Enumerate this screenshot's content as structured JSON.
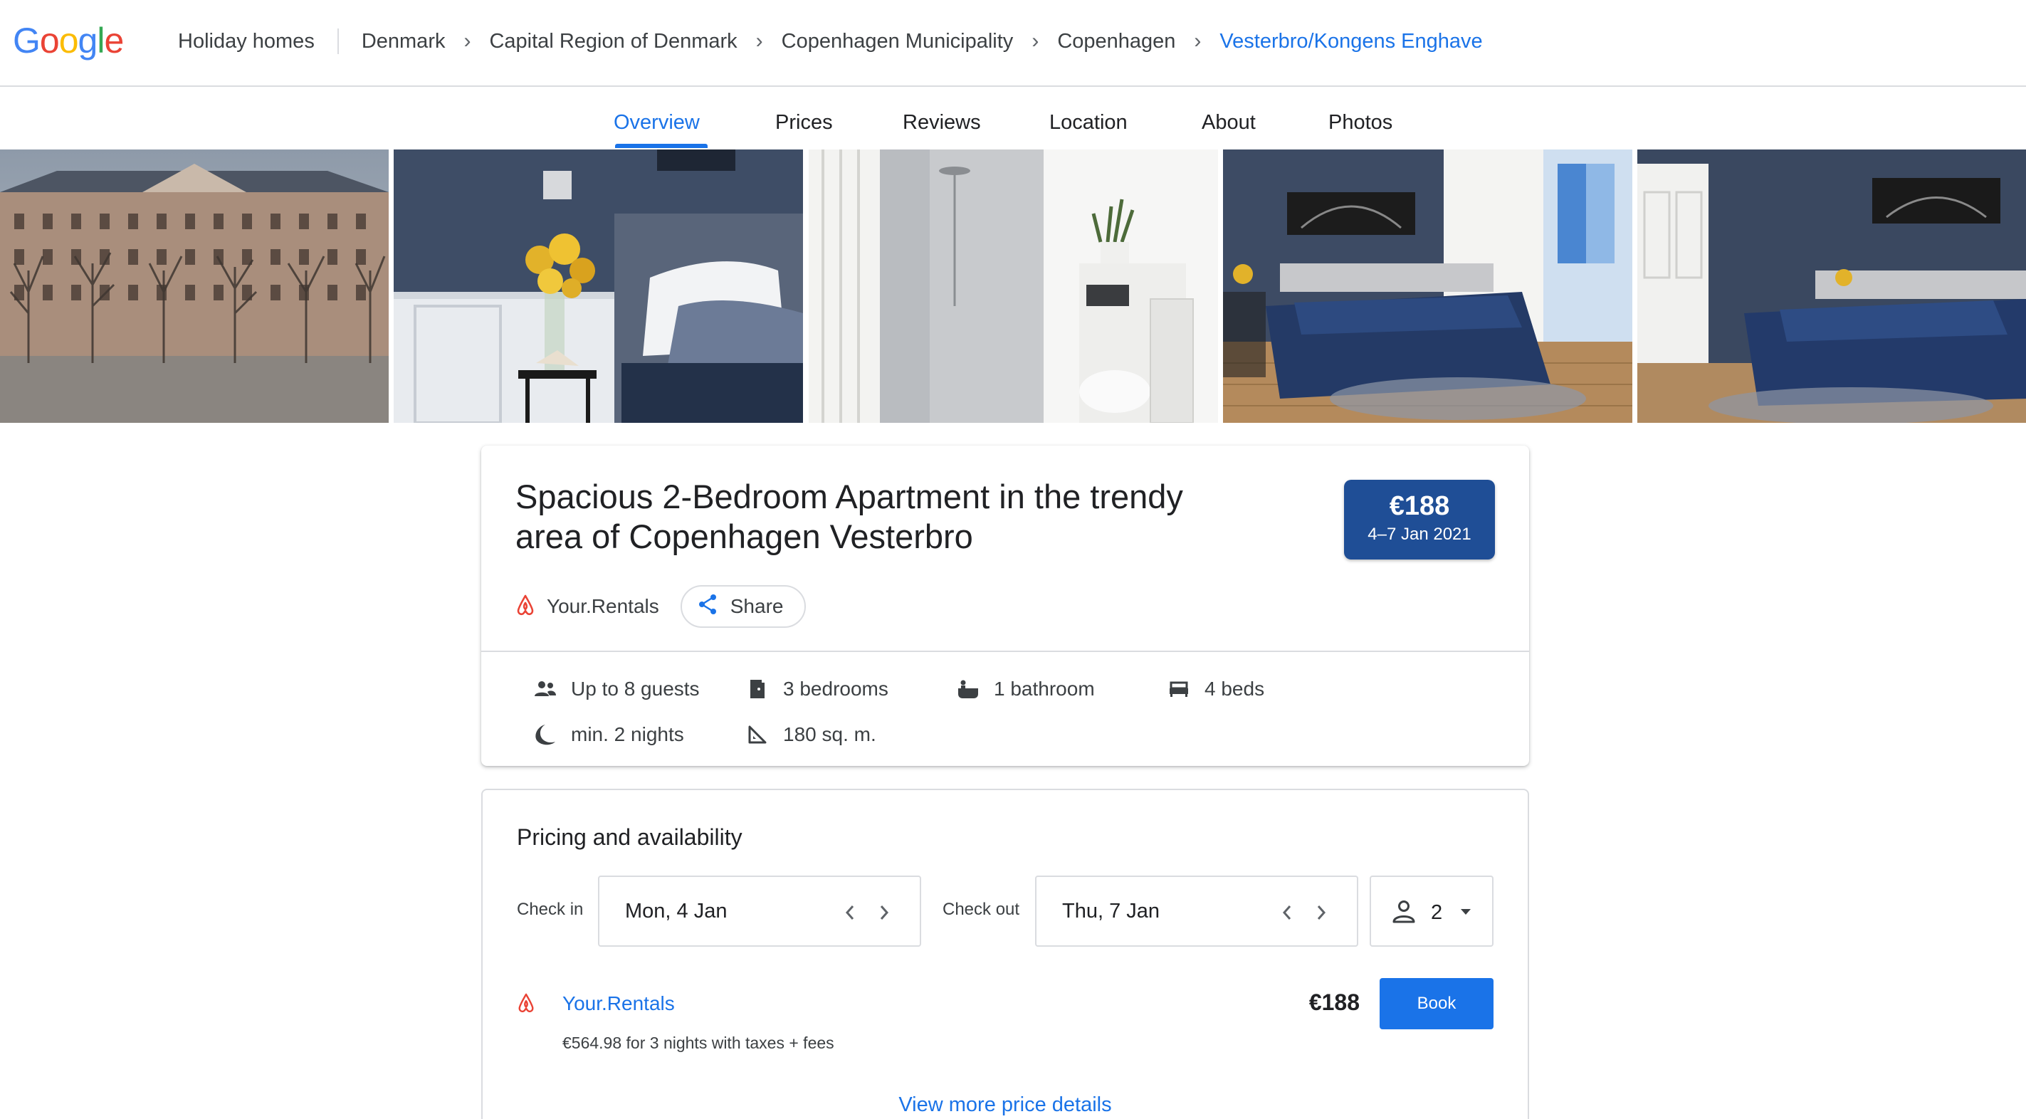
{
  "logo": {
    "text": "Google",
    "letters": [
      "G",
      "o",
      "o",
      "g",
      "l",
      "e"
    ],
    "colors": [
      "#4285f4",
      "#ea4335",
      "#fbbc05",
      "#4285f4",
      "#34a853",
      "#ea4335"
    ]
  },
  "breadcrumb": {
    "section": "Holiday homes",
    "items": [
      "Denmark",
      "Capital Region of Denmark",
      "Copenhagen Municipality",
      "Copenhagen",
      "Vesterbro/Kongens Enghave"
    ],
    "separator": "›"
  },
  "tabs": [
    "Overview",
    "Prices",
    "Reviews",
    "Location",
    "About",
    "Photos"
  ],
  "active_tab": "Overview",
  "photos": [
    "building-exterior-photo",
    "bedside-flowers-photo",
    "bathroom-shower-photo",
    "bedroom-wide-photo",
    "bedroom-door-photo"
  ],
  "listing": {
    "title": "Spacious 2-Bedroom Apartment in the trendy area of Copenhagen Vesterbro",
    "price": "€188",
    "dates": "4–7 Jan 2021",
    "provider": "Your.Rentals",
    "share_label": "Share"
  },
  "amenities": {
    "guests": "Up to 8 guests",
    "bedrooms": "3 bedrooms",
    "bathrooms": "1 bathroom",
    "beds": "4 beds",
    "min_nights": "min. 2 nights",
    "area": "180 sq. m."
  },
  "pricing": {
    "title": "Pricing and availability",
    "checkin_label": "Check in",
    "checkin_value": "Mon, 4 Jan",
    "checkout_label": "Check out",
    "checkout_value": "Thu, 7 Jan",
    "guests_value": "2",
    "offer_provider": "Your.Rentals",
    "offer_detail": "€564.98 for 3 nights with taxes + fees",
    "offer_price": "€188",
    "book_label": "Book",
    "more_link": "View more price details"
  },
  "colors": {
    "accent": "#1a73e8",
    "badge": "#1f4e96",
    "airbnb": "#ea4335"
  }
}
